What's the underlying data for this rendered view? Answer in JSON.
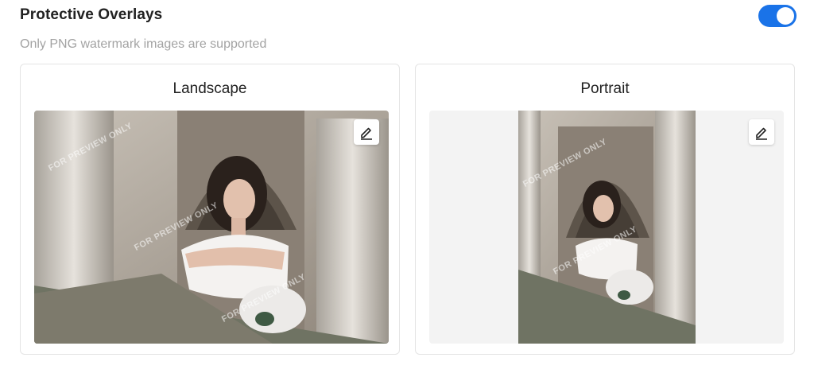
{
  "header": {
    "title": "Protective Overlays",
    "subtitle": "Only PNG watermark images are supported",
    "toggle_on": true,
    "accent_color": "#1a73e8"
  },
  "cards": [
    {
      "label": "Landscape",
      "edit_icon": "pencil-icon",
      "watermark_text": "FOR PREVIEW ONLY"
    },
    {
      "label": "Portrait",
      "edit_icon": "pencil-icon",
      "watermark_text": "FOR PREVIEW ONLY"
    }
  ]
}
